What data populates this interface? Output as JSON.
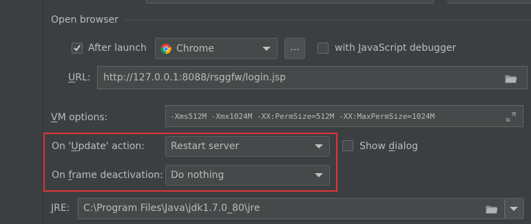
{
  "open_browser": {
    "section_title": "Open browser",
    "after_launch_label": "After launch",
    "browser_selected": "Chrome",
    "browse_button_label": "...",
    "js_debugger_prefix": "with ",
    "js_debugger_mnemonic": "J",
    "js_debugger_suffix": "avaScript debugger",
    "url_label_mnemonic": "U",
    "url_label_rest": "RL:",
    "url_value": "http://127.0.0.1:8088/rsggfw/login.jsp"
  },
  "vm": {
    "label_mnemonic": "V",
    "label_rest": "M options:",
    "value": "-Xms512M -Xmx1024M -XX:PermSize=512M -XX:MaxPermSize=1024M"
  },
  "update_action": {
    "label_prefix": "On '",
    "label_mnemonic": "U",
    "label_rest": "pdate' action:",
    "selected": "Restart server",
    "show_dialog_prefix": "Show ",
    "show_dialog_mnemonic": "d",
    "show_dialog_rest": "ialog"
  },
  "frame_deactivation": {
    "label_prefix": "On ",
    "label_mnemonic": "f",
    "label_rest": "rame deactivation:",
    "selected": "Do nothing"
  },
  "jre": {
    "label_mnemonic": "J",
    "label_rest": "RE:",
    "value": "C:\\Program Files\\Java\\jdk1.7.0_80\\jre"
  },
  "colors": {
    "background": "#3c3f41",
    "field": "#45494a",
    "highlight_box": "#e0343b"
  }
}
